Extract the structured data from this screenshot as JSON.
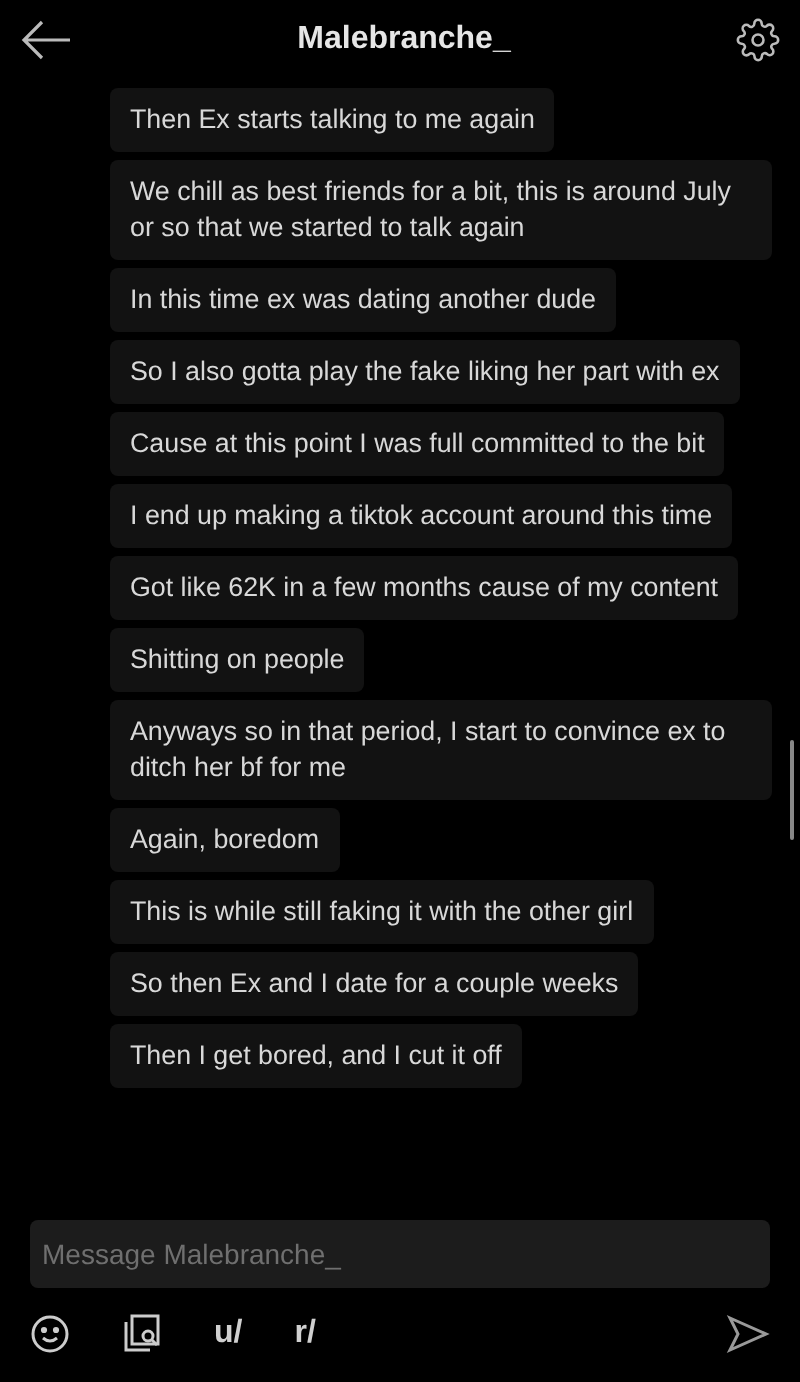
{
  "header": {
    "title": "Malebranche_"
  },
  "messages": [
    "Then Ex starts talking to me again",
    "We chill as best friends for a bit, this is around July or so that we started to talk again",
    "In this time ex was dating another dude",
    "So I also gotta play the fake liking her part with ex",
    "Cause at this point I was full committed to the bit",
    "I end up making a tiktok account around this time",
    "Got like 62K in a few months cause of my content",
    "Shitting on people",
    "Anyways so in that period, I start to convince ex to ditch her bf for me",
    "Again, boredom",
    "This is while still faking it with the other girl",
    "So then Ex and I date for a couple weeks",
    "Then I get bored, and I cut it off"
  ],
  "composer": {
    "placeholder": "Message Malebranche_"
  },
  "toolbar": {
    "user_prefix": "u/",
    "community_prefix": "r/"
  }
}
